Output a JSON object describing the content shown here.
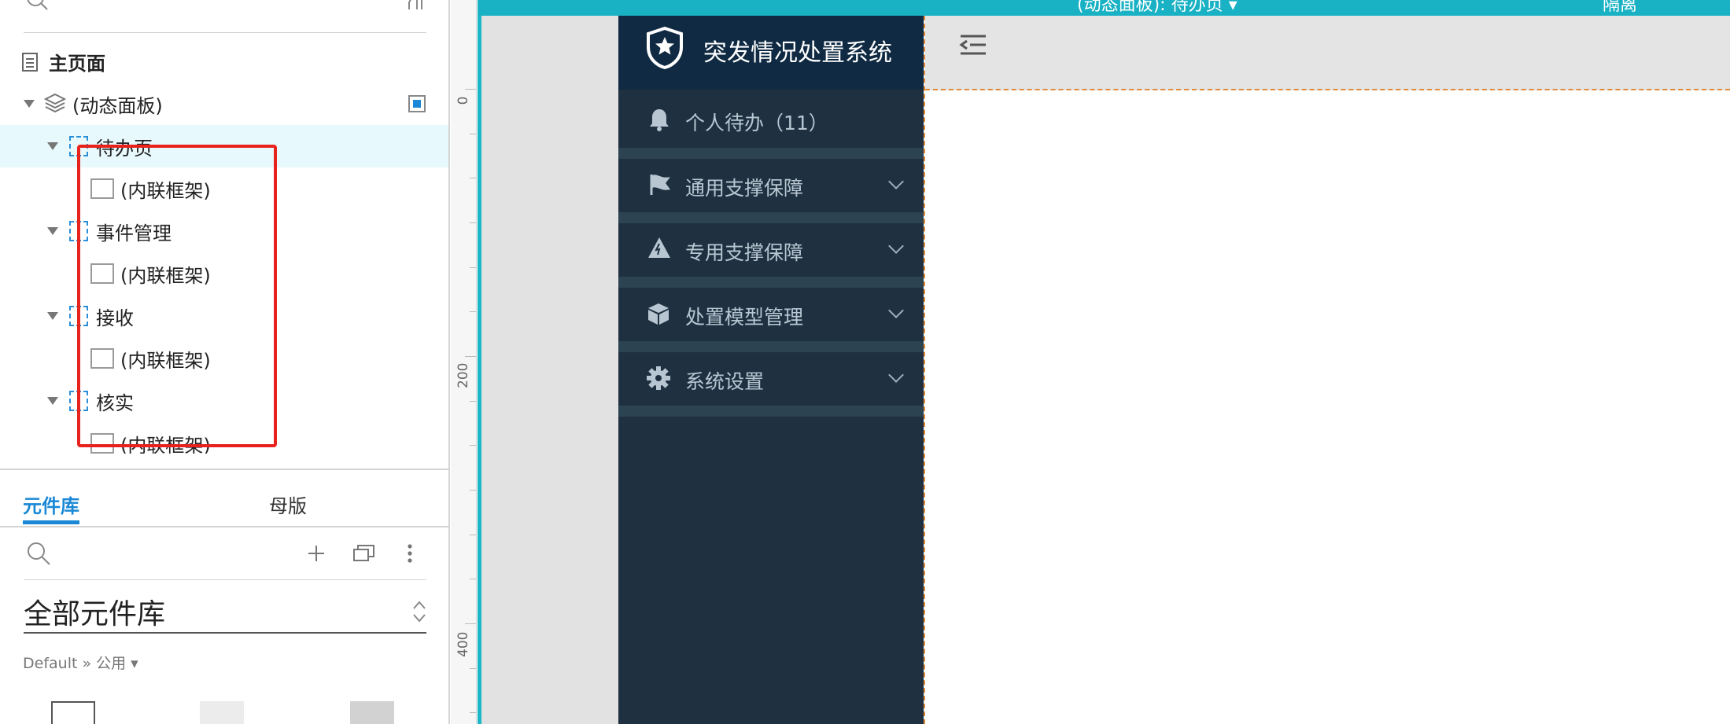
{
  "outline": {
    "home_label": "主页面",
    "dynamic_panel_label": "(动态面板)",
    "states": [
      {
        "label": "待办页",
        "child": "(内联框架)"
      },
      {
        "label": "事件管理",
        "child": "(内联框架)"
      },
      {
        "label": "接收",
        "child": "(内联框架)"
      },
      {
        "label": "核实",
        "child": "(内联框架)"
      }
    ]
  },
  "library": {
    "tab_library": "元件库",
    "tab_master": "母版",
    "title": "全部元件库",
    "breadcrumb": "Default » 公用 ▾"
  },
  "ruler": {
    "labels": [
      "0",
      "200",
      "400"
    ]
  },
  "canvas": {
    "top_title": "(动态面板): 待办页 ▾",
    "top_right": "隔离"
  },
  "app": {
    "title": "突发情况处置系统",
    "menu": [
      {
        "label": "个人待办（11）",
        "icon": "bell-icon",
        "has_chevron": false
      },
      {
        "label": "通用支撑保障",
        "icon": "flag-icon",
        "has_chevron": true
      },
      {
        "label": "专用支撑保障",
        "icon": "mountain-icon",
        "has_chevron": true
      },
      {
        "label": "处置模型管理",
        "icon": "cube-icon",
        "has_chevron": true
      },
      {
        "label": "系统设置",
        "icon": "gear-icon",
        "has_chevron": true
      }
    ]
  },
  "colors": {
    "accent": "#1aa3e8",
    "sidebar": "#1f3140",
    "header": "#0f2a42",
    "topbar": "#19b1c4",
    "highlight_box": "#e8231d"
  }
}
